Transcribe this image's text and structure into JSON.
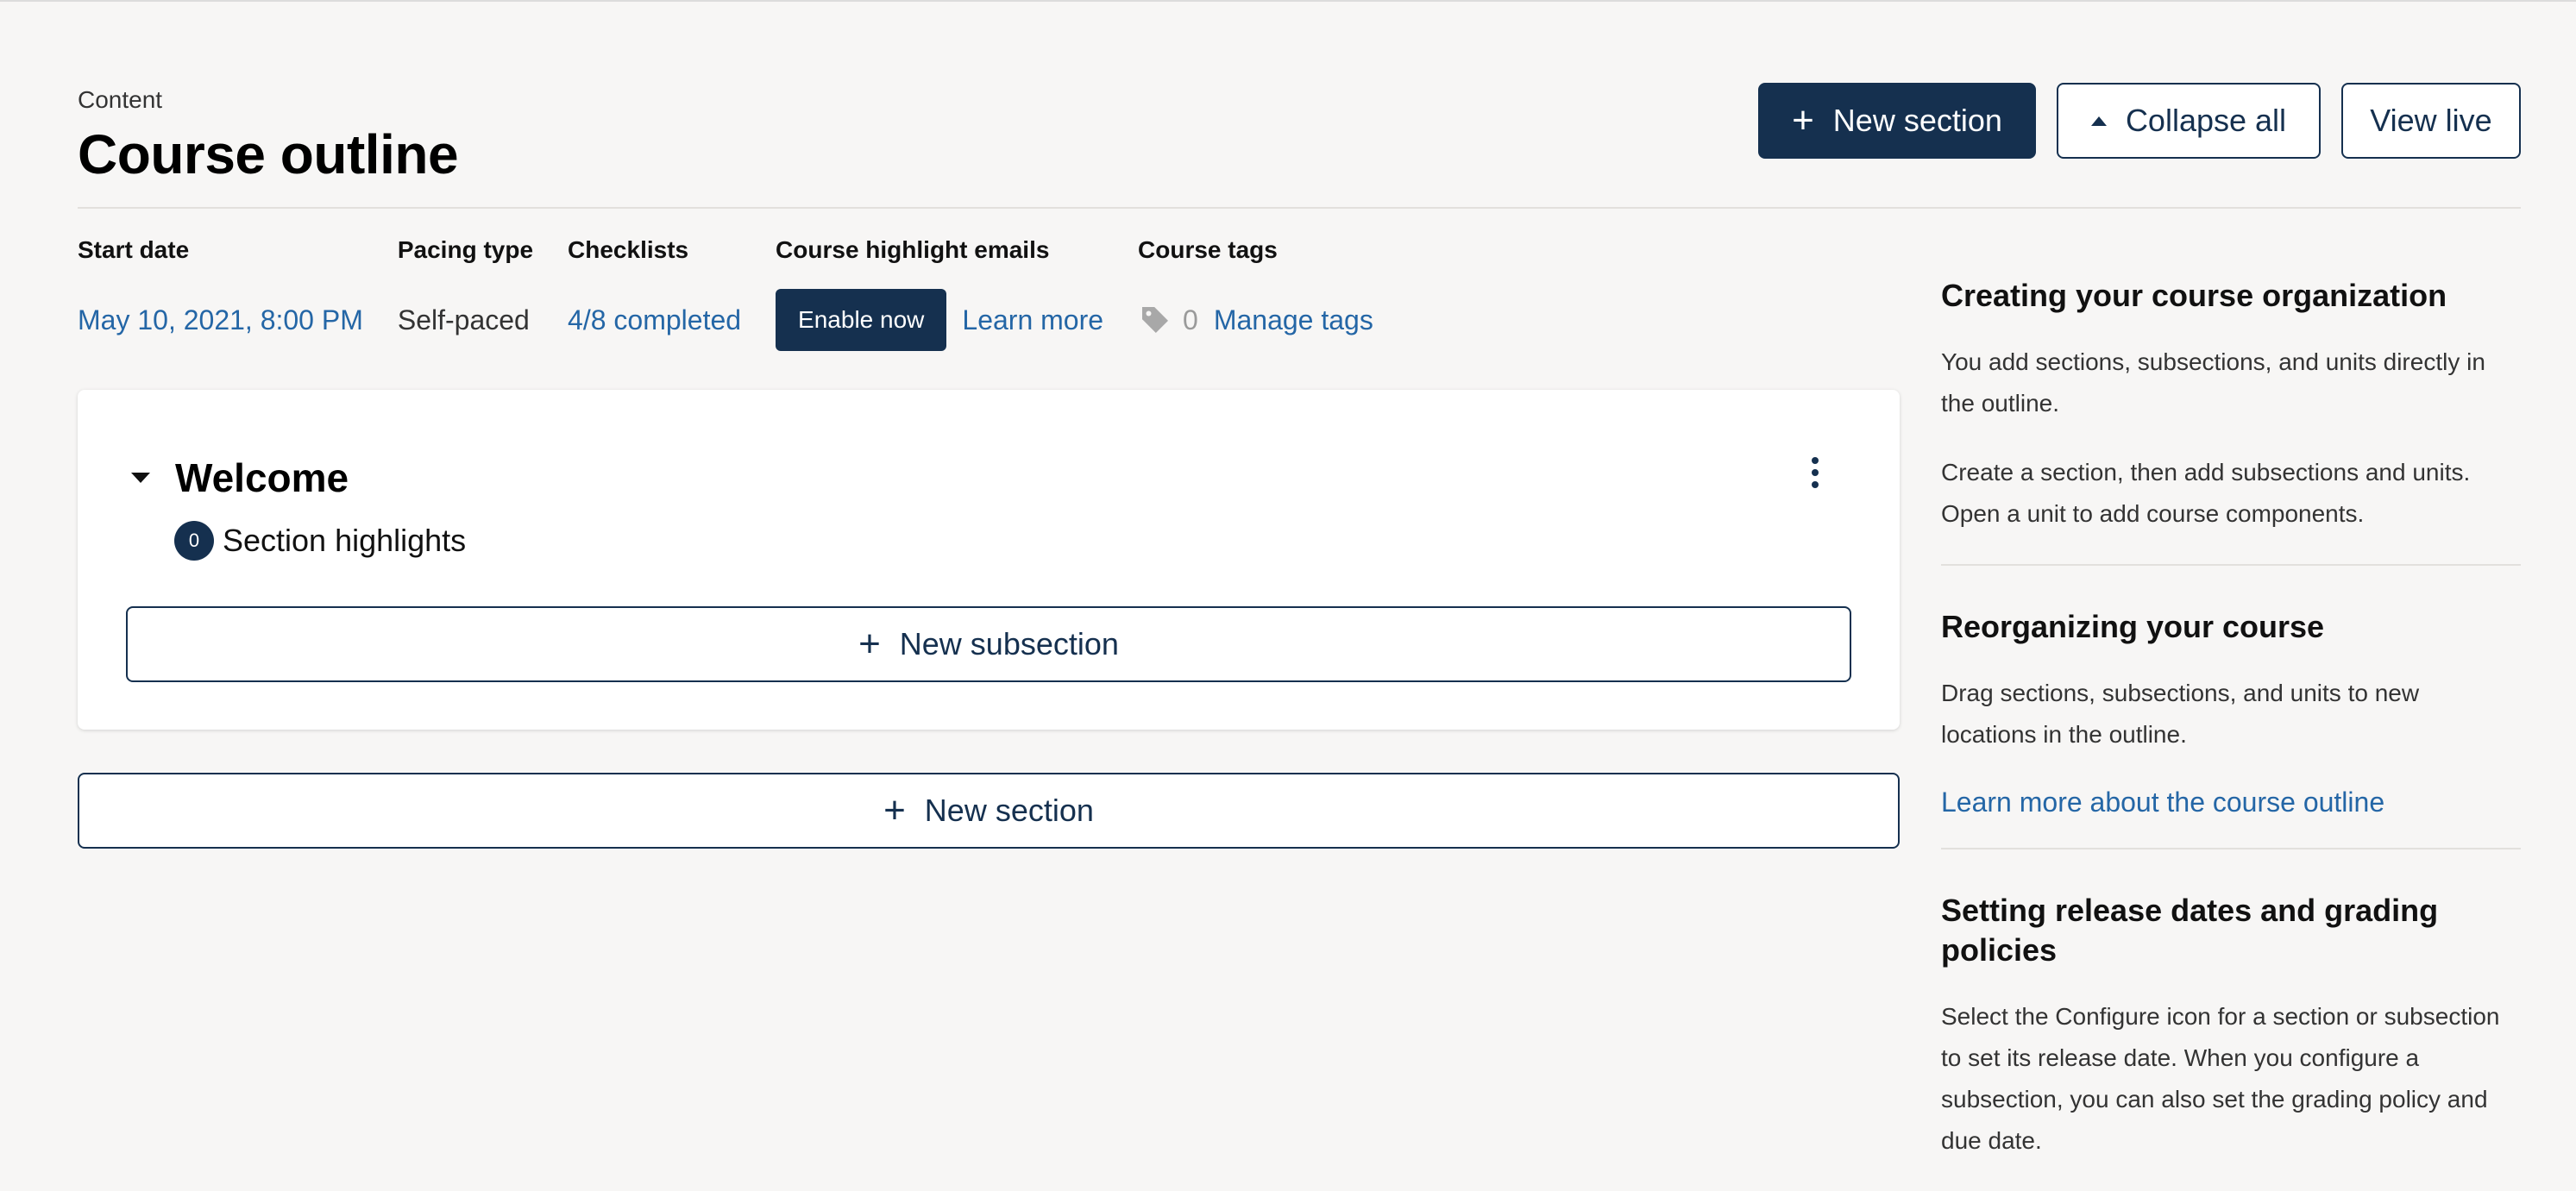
{
  "header": {
    "breadcrumb": "Content",
    "title": "Course outline",
    "new_section_label": "New section",
    "collapse_all_label": "Collapse all",
    "view_live_label": "View live"
  },
  "status": {
    "start_date_label": "Start date",
    "start_date_value": "May 10, 2021, 8:00 PM",
    "pacing_label": "Pacing type",
    "pacing_value": "Self-paced",
    "checklists_label": "Checklists",
    "checklists_value": "4/8 completed",
    "highlight_emails_label": "Course highlight emails",
    "enable_now_label": "Enable now",
    "learn_more_label": "Learn more",
    "tags_label": "Course tags",
    "tags_count": "0",
    "manage_tags_label": "Manage tags"
  },
  "section": {
    "title": "Welcome",
    "highlights_count": "0",
    "highlights_label": "Section highlights",
    "new_subsection_label": "New subsection"
  },
  "bottom": {
    "new_section_label": "New section"
  },
  "sidebar": {
    "block1": {
      "title": "Creating your course organization",
      "p1": "You add sections, subsections, and units directly in the outline.",
      "p2": "Create a section, then add subsections and units. Open a unit to add course components."
    },
    "block2": {
      "title": "Reorganizing your course",
      "p1": "Drag sections, subsections, and units to new locations in the outline.",
      "link": "Learn more about the course outline"
    },
    "block3": {
      "title": "Setting release dates and grading policies",
      "p1": "Select the Configure icon for a section or subsection to set its release date. When you configure a subsection, you can also set the grading policy and due date."
    }
  },
  "colors": {
    "primary": "#15304f",
    "link": "#2466a6",
    "background": "#f7f6f5"
  }
}
